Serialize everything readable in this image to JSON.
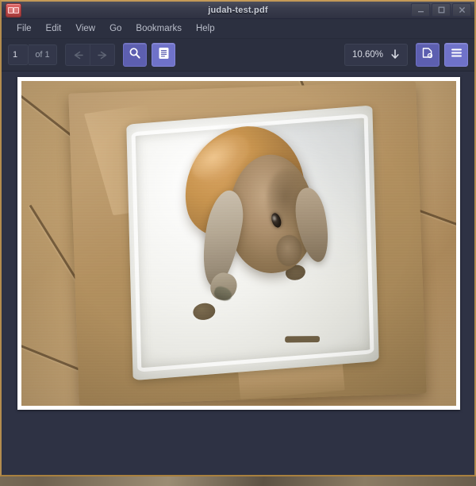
{
  "window": {
    "title": "judah-test.pdf",
    "app_icon": "document-viewer-icon",
    "controls": {
      "minimize": "minimize-icon",
      "maximize": "maximize-icon",
      "close": "close-icon"
    }
  },
  "menubar": {
    "items": [
      {
        "label": "File"
      },
      {
        "label": "Edit"
      },
      {
        "label": "View"
      },
      {
        "label": "Go"
      },
      {
        "label": "Bookmarks"
      },
      {
        "label": "Help"
      }
    ]
  },
  "toolbar": {
    "page_number": "1",
    "page_total_label": "of 1",
    "previous_page_icon": "arrow-left-icon",
    "next_page_icon": "arrow-right-icon",
    "find_icon": "magnifier-icon",
    "sidebar_icon": "document-pane-icon",
    "zoom_value": "10.60%",
    "zoom_dropdown_icon": "arrow-down-icon",
    "page_setup_icon": "page-settings-icon",
    "menu_icon": "hamburger-menu-icon"
  },
  "document": {
    "page_label": "1",
    "content_description": "Photograph of a lop-eared rabbit sitting on white foam packing material inside a cardboard box on a tiled floor"
  },
  "colors": {
    "accent": "#5d5fb0",
    "accent_light": "#6f72c9",
    "chrome_dark": "#2b2f3f",
    "canvas": "#2e3244",
    "window_border": "#b38c4e",
    "title_text": "#c8ccd6",
    "menu_text": "#b9bdc9"
  }
}
